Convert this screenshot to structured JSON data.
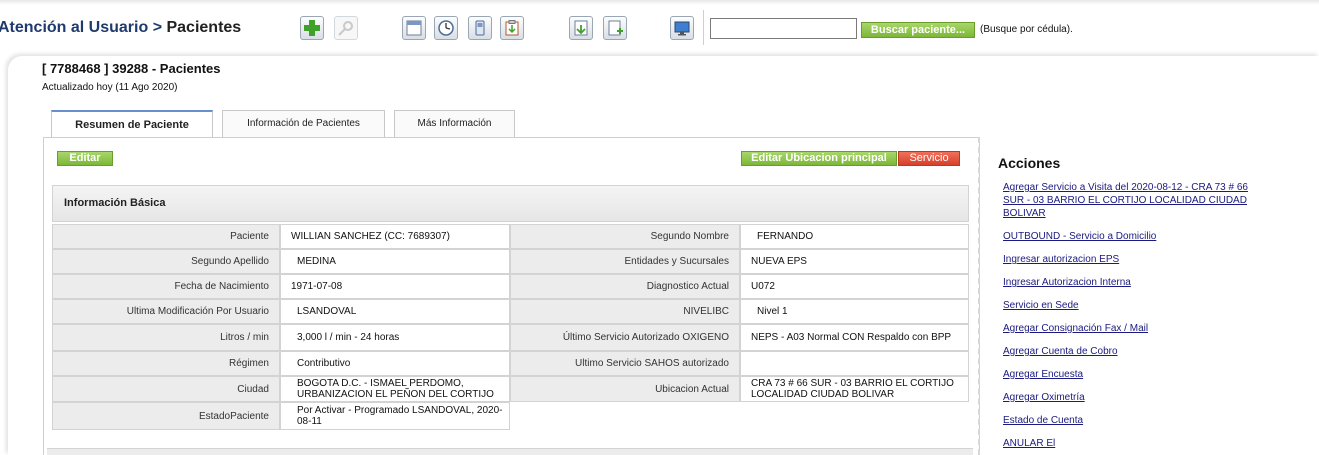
{
  "header": {
    "breadcrumb_parent": "Atención al Usuario",
    "breadcrumb_sep": " > ",
    "breadcrumb_current": "Pacientes",
    "toolbar_icons": [
      "add-icon",
      "magnifier-icon",
      "calendar-window-icon",
      "clock-icon",
      "phone-icon",
      "clipboard-icon",
      "download-icon",
      "document-add-icon",
      "monitor-icon"
    ],
    "search_value": "",
    "search_button": "Buscar paciente...",
    "search_hint": "(Busque por cédula)."
  },
  "page": {
    "title": "[ 7788468 ] 39288 - Pacientes",
    "subtitle": "Actualizado hoy (11 Ago 2020)"
  },
  "tabs": [
    {
      "label": "Resumen de Paciente",
      "active": true
    },
    {
      "label": "Información de Pacientes",
      "active": false
    },
    {
      "label": "Más Información",
      "active": false
    }
  ],
  "buttons": {
    "edit": "Editar",
    "edit_location": "Editar Ubicacion principal",
    "service": "Servicio"
  },
  "section": {
    "title": "Información Básica"
  },
  "fields": {
    "paciente": {
      "label": "Paciente",
      "value": "WILLIAN SANCHEZ (CC: 7689307)"
    },
    "segundo_nombre": {
      "label": "Segundo Nombre",
      "value": "FERNANDO"
    },
    "segundo_apellido": {
      "label": "Segundo Apellido",
      "value": "MEDINA"
    },
    "entidades": {
      "label": "Entidades y Sucursales",
      "value": "NUEVA EPS"
    },
    "fecha_nacimiento": {
      "label": "Fecha de Nacimiento",
      "value": "1971-07-08"
    },
    "diagnostico": {
      "label": "Diagnostico Actual",
      "value": "U072"
    },
    "ultima_modificacion": {
      "label": "Ultima Modificación Por Usuario",
      "value": "LSANDOVAL"
    },
    "nivelibc": {
      "label": "NIVELIBC",
      "value": "Nivel 1"
    },
    "litros": {
      "label": "Litros / min",
      "value": "3,000 l / min - 24 horas"
    },
    "ultimo_oxigeno": {
      "label": "Último Servicio Autorizado OXIGENO",
      "value": "NEPS - A03 Normal CON Respaldo con BPP"
    },
    "regimen": {
      "label": "Régimen",
      "value": "Contributivo"
    },
    "ultimo_sahos": {
      "label": "Ultimo Servicio SAHOS autorizado",
      "value": ""
    },
    "ciudad": {
      "label": "Ciudad",
      "value": "BOGOTA D.C. - ISMAEL PERDOMO, URBANIZACION EL PEÑON DEL CORTIJO"
    },
    "ubicacion": {
      "label": "Ubicacion Actual",
      "value": "CRA 73 # 66 SUR - 03 BARRIO EL CORTIJO LOCALIDAD CIUDAD BOLIVAR"
    },
    "estado": {
      "label": "EstadoPaciente",
      "value": "Por Activar - Programado LSANDOVAL, 2020-08-11"
    }
  },
  "actions": {
    "title": "Acciones",
    "items": [
      "Agregar Servicio a Visita del 2020-08-12 - CRA 73 # 66 SUR - 03 BARRIO EL CORTIJO LOCALIDAD CIUDAD BOLIVAR",
      "OUTBOUND - Servicio a Domicilio",
      "Ingresar autorizacion EPS",
      "Ingresar Autorizacion Interna",
      "Servicio en Sede",
      "Agregar Consignación Fax / Mail",
      "Agregar Cuenta de Cobro",
      "Agregar Encuesta",
      "Agregar Oximetría",
      "Estado de Cuenta",
      "ANULAR El"
    ]
  },
  "colors": {
    "accent_green": "#7cb737",
    "service_red": "#d6402a",
    "link_blue": "#1a1a80",
    "breadcrumb_blue": "#1f3a6e"
  }
}
